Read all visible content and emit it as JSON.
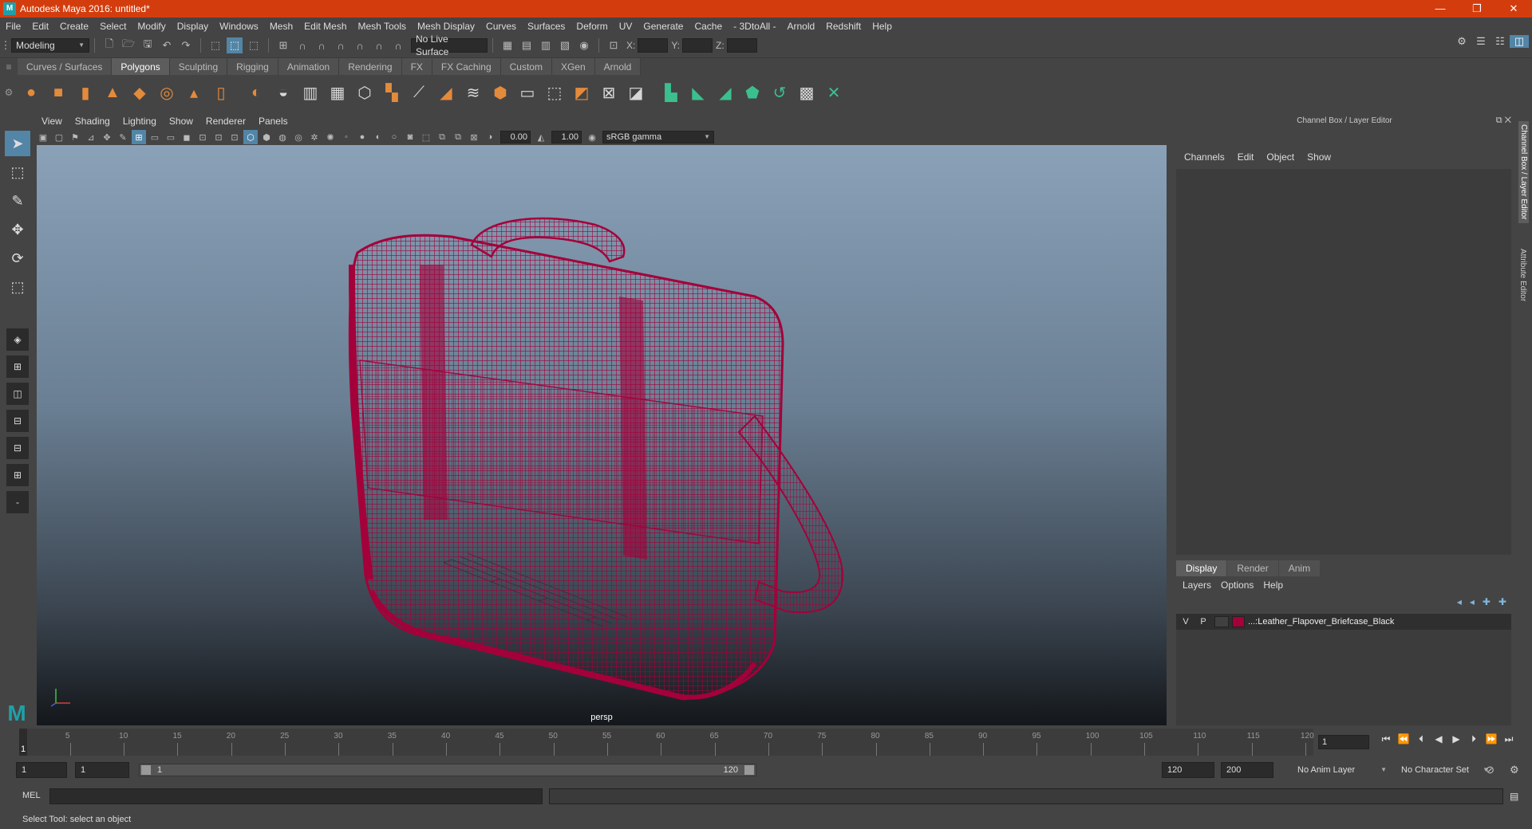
{
  "window": {
    "title": "Autodesk Maya 2016: untitled*",
    "logo": "M",
    "controls": [
      "—",
      "❐",
      "✕"
    ]
  },
  "menu": [
    "File",
    "Edit",
    "Create",
    "Select",
    "Modify",
    "Display",
    "Windows",
    "Mesh",
    "Edit Mesh",
    "Mesh Tools",
    "Mesh Display",
    "Curves",
    "Surfaces",
    "Deform",
    "UV",
    "Generate",
    "Cache",
    "- 3DtoAll -",
    "Arnold",
    "Redshift",
    "Help"
  ],
  "statusline": {
    "mode": "Modeling",
    "live_surface": "No Live Surface",
    "x_label": "X:",
    "y_label": "Y:",
    "z_label": "Z:"
  },
  "shelf": {
    "tabs": [
      "Curves / Surfaces",
      "Polygons",
      "Sculpting",
      "Rigging",
      "Animation",
      "Rendering",
      "FX",
      "FX Caching",
      "Custom",
      "XGen",
      "Arnold"
    ],
    "active": "Polygons"
  },
  "viewport": {
    "menu": [
      "View",
      "Shading",
      "Lighting",
      "Show",
      "Renderer",
      "Panels"
    ],
    "exposure": "0.00",
    "gamma": "1.00",
    "color_space": "sRGB gamma",
    "camera": "persp",
    "wire_color": "#a4003a",
    "axis_x": "#d04040",
    "axis_y": "#40c040",
    "axis_z": "#4060e0"
  },
  "channel_box": {
    "title": "Channel Box / Layer Editor",
    "menu": [
      "Channels",
      "Edit",
      "Object",
      "Show"
    ]
  },
  "layer_editor": {
    "tabs": [
      "Display",
      "Render",
      "Anim"
    ],
    "menu": [
      "Layers",
      "Options",
      "Help"
    ],
    "layers": [
      {
        "v": "V",
        "p": "P",
        "color": "#a4003a",
        "name": "...:Leather_Flapover_Briefcase_Black"
      }
    ]
  },
  "side_tabs": [
    "Channel Box / Layer Editor",
    "Attribute Editor"
  ],
  "timeline": {
    "ticks": [
      "5",
      "10",
      "15",
      "20",
      "25",
      "30",
      "35",
      "40",
      "45",
      "50",
      "55",
      "60",
      "65",
      "70",
      "75",
      "80",
      "85",
      "90",
      "95",
      "100",
      "105",
      "110",
      "115",
      "120"
    ],
    "current": "1",
    "current_field": "1"
  },
  "range": {
    "start": "1",
    "playback_start": "1",
    "slider_start": "1",
    "slider_end": "120",
    "playback_end": "120",
    "end": "200",
    "anim_layer": "No Anim Layer",
    "character_set": "No Character Set"
  },
  "command": {
    "label": "MEL"
  },
  "help": {
    "text": "Select Tool: select an object"
  }
}
